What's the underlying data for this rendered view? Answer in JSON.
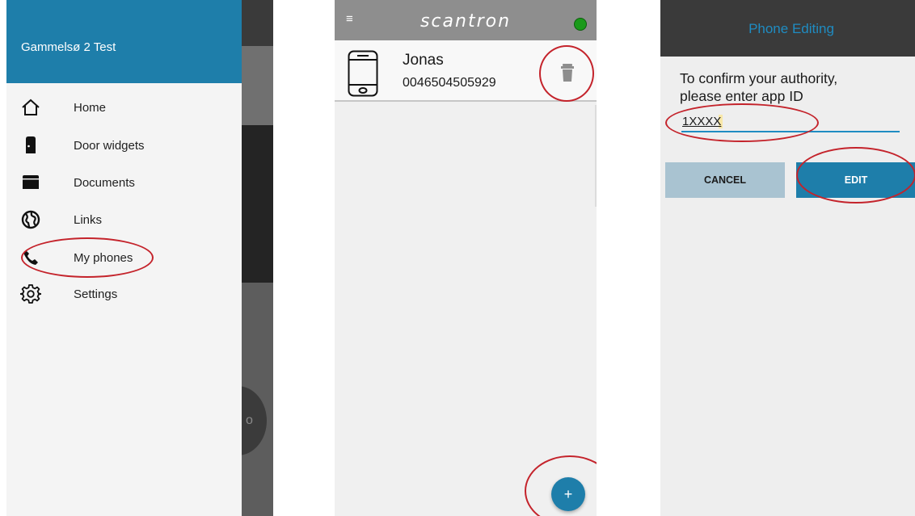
{
  "drawer": {
    "title": "Gammelsø 2 Test",
    "items": [
      {
        "label": "Home",
        "icon": "home-icon"
      },
      {
        "label": "Door widgets",
        "icon": "door-icon"
      },
      {
        "label": "Documents",
        "icon": "folder-icon"
      },
      {
        "label": "Links",
        "icon": "globe-icon"
      },
      {
        "label": "My phones",
        "icon": "phone-icon"
      },
      {
        "label": "Settings",
        "icon": "gear-icon"
      }
    ]
  },
  "phones": {
    "hamburger": "≡",
    "brand": "scantron",
    "status_color": "#1a9a1a",
    "entry": {
      "name": "Jonas",
      "number": "0046504505929"
    },
    "fab_label": "+"
  },
  "editor": {
    "title": "Phone Editing",
    "prompt_line1": "To confirm your authority,",
    "prompt_line2": "please enter app ID",
    "app_id_value": "1XXXX",
    "cancel_label": "CANCEL",
    "edit_label": "EDIT"
  },
  "colors": {
    "accent": "#1e7eaa",
    "highlight_ring": "#c4232b"
  }
}
